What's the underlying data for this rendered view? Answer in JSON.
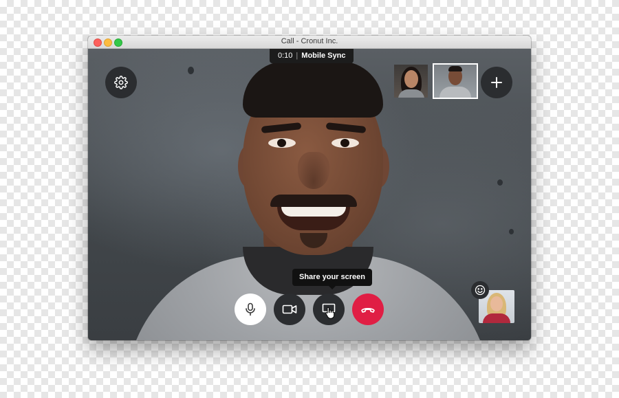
{
  "window": {
    "title": "Call - Cronut Inc."
  },
  "call": {
    "duration": "0:10",
    "separator": "|",
    "channel": "Mobile Sync"
  },
  "tooltip": {
    "text": "Share your screen"
  },
  "icons": {
    "settings": "gear-icon",
    "add": "plus-icon",
    "mic": "microphone-icon",
    "video": "video-camera-icon",
    "share": "screen-share-icon",
    "end": "hang-up-icon",
    "emoji": "smiley-icon"
  },
  "colors": {
    "end_call": "#e01e44",
    "control_dark": "#2b2d30",
    "control_light": "#ffffff",
    "tooltip_bg": "#111111"
  }
}
